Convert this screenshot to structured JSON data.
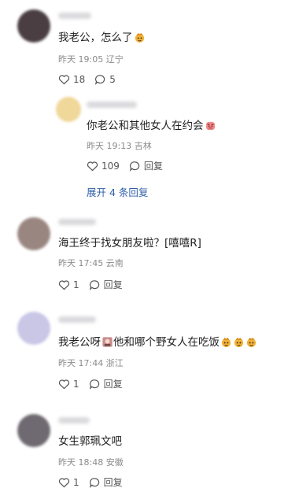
{
  "comments": [
    {
      "text": "我老公，怎么了",
      "time": "昨天 19:05",
      "location": "辽宁",
      "likes": "18",
      "replies": "5",
      "avatar_color": "#4a3e43",
      "emoji": "face-emoji"
    },
    {
      "text": "你老公和其他女人在约会",
      "time": "昨天 19:13",
      "location": "吉林",
      "likes": "109",
      "reply_label": "回复",
      "avatar_color": "#f0d79a",
      "emoji": "angry-emoji"
    },
    {
      "text": "海王终于找女朋友啦？[嘻嘻R]",
      "time": "昨天 17:45",
      "location": "云南",
      "likes": "1",
      "reply_label": "回复",
      "avatar_color": "#9a8680"
    },
    {
      "text_a": "我老公呀",
      "text_b": "他和哪个野女人在吃饭",
      "time": "昨天 17:44",
      "location": "浙江",
      "likes": "1",
      "reply_label": "回复",
      "avatar_color": "#c9c6e6"
    },
    {
      "text": "女生郭珮文吧",
      "time": "昨天 18:48",
      "location": "安徽",
      "likes": "1",
      "reply_label": "回复",
      "avatar_color": "#6f6a72"
    }
  ],
  "expand_label": "展开 4 条回复",
  "colors": {
    "link": "#2f5fa8",
    "meta": "#8a8a8a",
    "icon": "#555555"
  }
}
